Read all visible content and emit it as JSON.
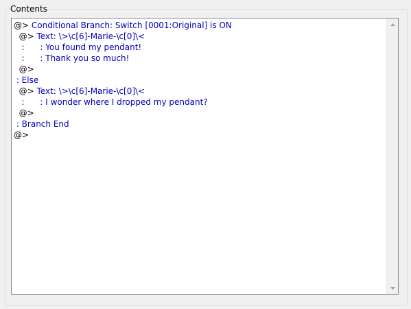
{
  "group": {
    "title": "Contents"
  },
  "colors": {
    "command": "#0000c0",
    "default": "#000000"
  },
  "contents": {
    "rows": [
      {
        "segments": [
          {
            "text": "@>",
            "color": "#000000"
          },
          {
            "text": " Conditional Branch: Switch [0001:Original] is ON",
            "color": "#0000c0"
          }
        ]
      },
      {
        "segments": [
          {
            "text": "  @>",
            "color": "#000000"
          },
          {
            "text": " Text: \\>\\c[6]-Marie-\\c[0]\\<",
            "color": "#0000c0"
          }
        ]
      },
      {
        "segments": [
          {
            "text": "   :      ",
            "color": "#000000"
          },
          {
            "text": ": You found my pendant!",
            "color": "#0000c0"
          }
        ]
      },
      {
        "segments": [
          {
            "text": "   :      ",
            "color": "#000000"
          },
          {
            "text": ": Thank you so much!",
            "color": "#0000c0"
          }
        ]
      },
      {
        "segments": [
          {
            "text": "  @>",
            "color": "#000000"
          }
        ]
      },
      {
        "segments": [
          {
            "text": " : Else",
            "color": "#0000c0"
          }
        ]
      },
      {
        "segments": [
          {
            "text": "  @>",
            "color": "#000000"
          },
          {
            "text": " Text: \\>\\c[6]-Marie-\\c[0]\\<",
            "color": "#0000c0"
          }
        ]
      },
      {
        "segments": [
          {
            "text": "   :      ",
            "color": "#000000"
          },
          {
            "text": ": I wonder where I dropped my pendant?",
            "color": "#0000c0"
          }
        ]
      },
      {
        "segments": [
          {
            "text": "  @>",
            "color": "#000000"
          }
        ]
      },
      {
        "segments": [
          {
            "text": " : Branch End",
            "color": "#0000c0"
          }
        ]
      },
      {
        "segments": [
          {
            "text": "@>",
            "color": "#000000"
          }
        ]
      }
    ]
  },
  "scrollbar": {
    "up_icon": "scroll-up-arrow-icon",
    "down_icon": "scroll-down-arrow-icon"
  }
}
